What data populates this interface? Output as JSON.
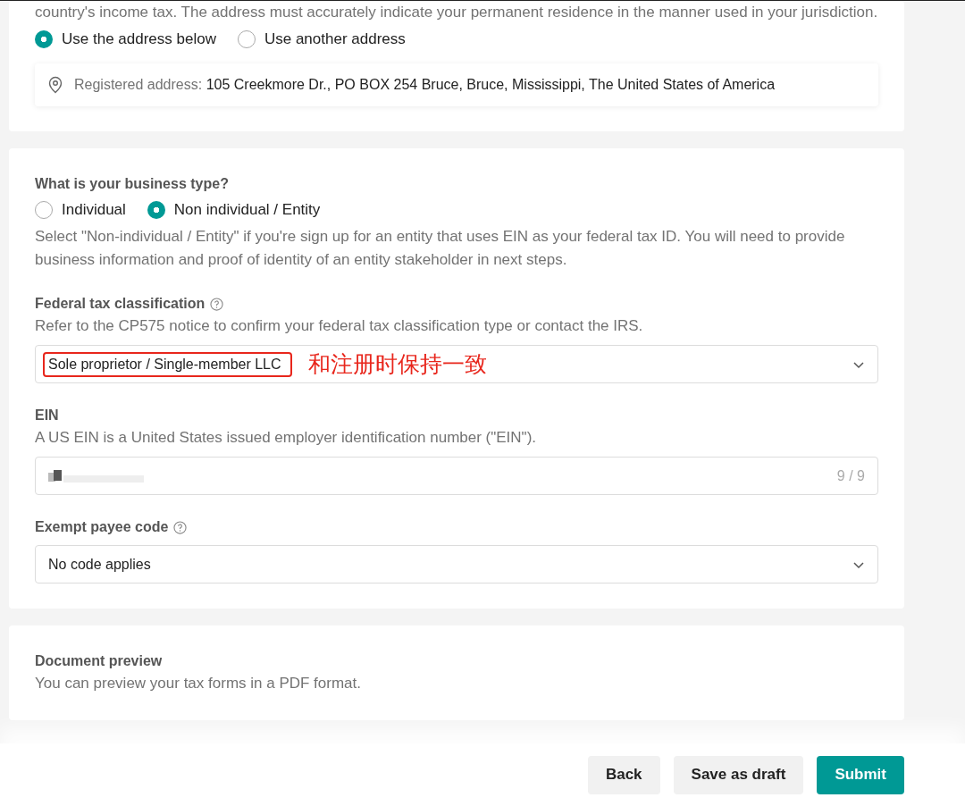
{
  "residence_card": {
    "intro": "country's income tax. The address must accurately indicate your permanent residence in the manner used in your jurisdiction.",
    "address_options": [
      {
        "label": "Use the address below",
        "selected": true
      },
      {
        "label": "Use another address",
        "selected": false
      }
    ],
    "address": {
      "label": "Registered address:",
      "value": "105 Creekmore Dr., PO BOX 254 Bruce, Bruce, Mississippi, The United States of America"
    }
  },
  "business_card": {
    "question": "What is your business type?",
    "business_types": [
      {
        "label": "Individual",
        "selected": false
      },
      {
        "label": "Non individual / Entity",
        "selected": true
      }
    ],
    "hint": "Select \"Non-individual / Entity\" if you're sign up for an entity that uses EIN as your federal tax ID. You will need to provide business information and proof of identity of an entity stakeholder in next steps.",
    "fields": [
      {
        "kind": "select",
        "label": "Federal tax classification",
        "help": true,
        "description": "Refer to the CP575 notice to confirm your federal tax classification type or contact the IRS.",
        "value": "Sole proprietor / Single-member LLC",
        "annotation": "和注册时保持一致"
      },
      {
        "kind": "input",
        "label": "EIN",
        "description": "A US EIN is a United States issued employer identification number (\"EIN\").",
        "redacted": true,
        "counter": "9 / 9"
      },
      {
        "kind": "select",
        "label": "Exempt payee code",
        "help": true,
        "value": "No code applies"
      }
    ]
  },
  "preview_card": {
    "title": "Document preview",
    "description": "You can preview your tax forms in a PDF format."
  },
  "footer": {
    "buttons": [
      {
        "label": "Back",
        "kind": "secondary"
      },
      {
        "label": "Save as draft",
        "kind": "secondary"
      },
      {
        "label": "Submit",
        "kind": "primary"
      }
    ]
  }
}
